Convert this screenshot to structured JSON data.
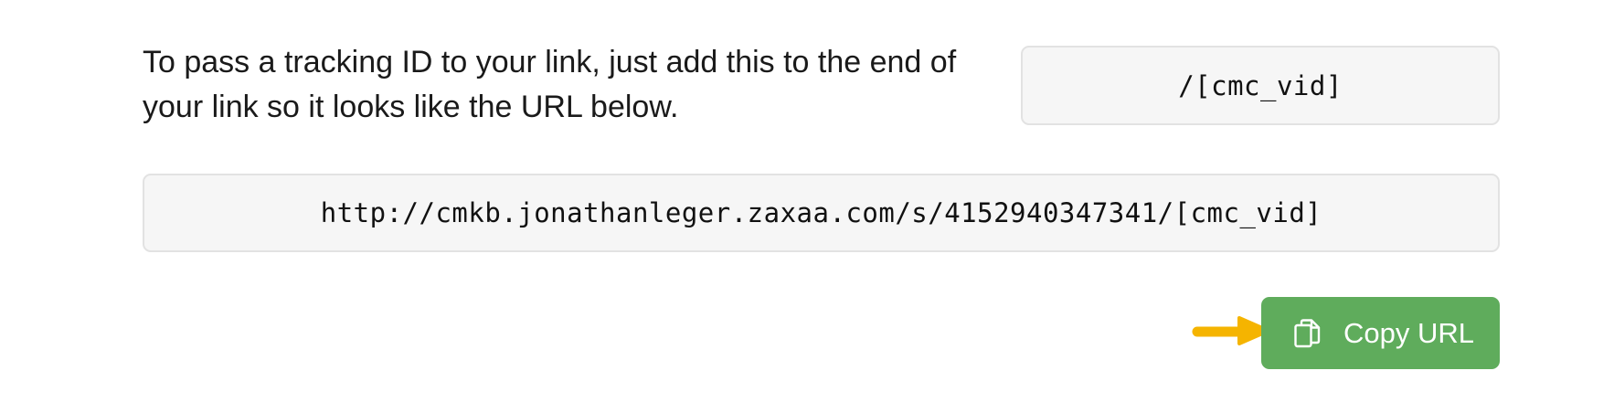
{
  "instructions": {
    "text": "To pass a tracking ID to your link, just add this to the end of your link so it looks like the URL below."
  },
  "param_box": {
    "value": "/[cmc_vid]"
  },
  "url_box": {
    "value": "http://cmkb.jonathanleger.zaxaa.com/s/4152940347341/[cmc_vid]"
  },
  "copy_button": {
    "label": "Copy URL",
    "icon": "copy-icon",
    "color": "#5fac5c"
  },
  "pointer": {
    "icon": "arrow-right-icon",
    "color": "#f5b400"
  }
}
